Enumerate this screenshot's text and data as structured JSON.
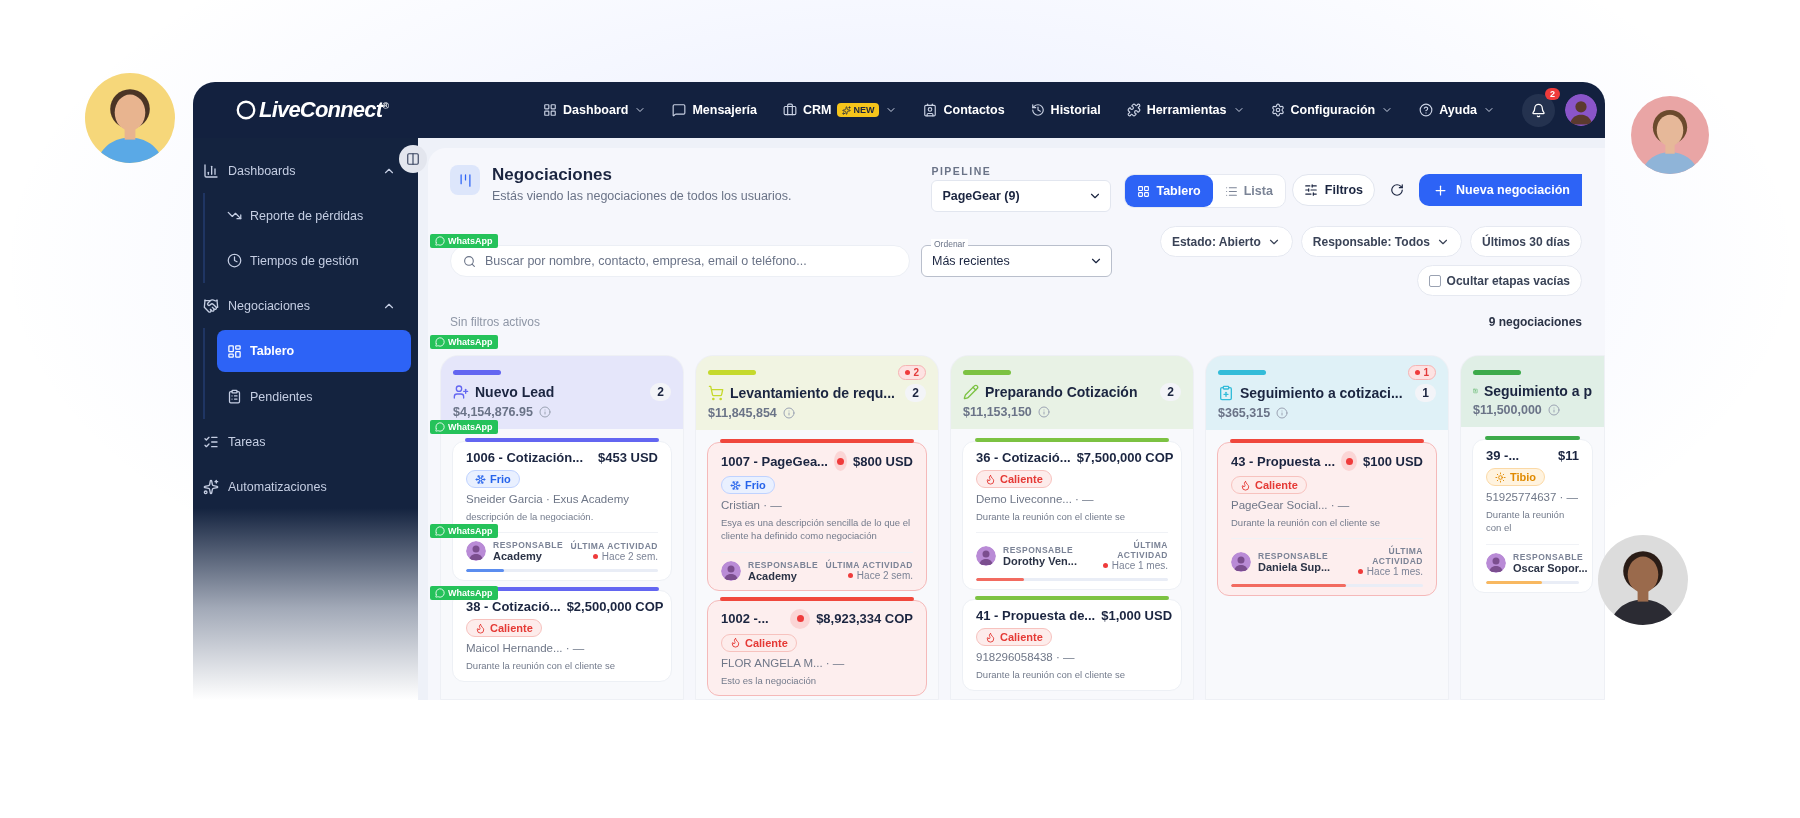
{
  "nav": {
    "logo": "LiveConnect$^{®}$",
    "items": [
      {
        "label": "Dashboard",
        "menu": true
      },
      {
        "label": "Mensajería",
        "menu": false
      },
      {
        "label": "CRM",
        "badge": "NEW",
        "menu": true
      },
      {
        "label": "Contactos",
        "menu": false
      },
      {
        "label": "Historial",
        "menu": false
      },
      {
        "label": "Herramientas",
        "menu": true
      },
      {
        "label": "Configuración",
        "menu": true
      },
      {
        "label": "Ayuda",
        "menu": true
      }
    ],
    "notifications": "2"
  },
  "sidebar": {
    "items": [
      {
        "label": "Dashboards",
        "expanded": true,
        "children": [
          {
            "label": "Reporte de pérdidas",
            "selected": false
          },
          {
            "label": "Tiempos de gestión",
            "selected": false
          }
        ]
      },
      {
        "label": "Negociaciones",
        "expanded": true,
        "children": [
          {
            "label": "Tablero",
            "selected": true
          },
          {
            "label": "Pendientes",
            "selected": false
          }
        ]
      },
      {
        "label": "Tareas"
      },
      {
        "label": "Automatizaciones"
      }
    ]
  },
  "header": {
    "title": "Negociaciones",
    "subtitle": "Estás viendo las negociaciones de todos los usuarios.",
    "pipeline": {
      "label": "PIPELINE",
      "value": "PageGear (9)"
    },
    "views": [
      {
        "label": "Tablero",
        "selected": true
      },
      {
        "label": "Lista",
        "selected": false
      }
    ],
    "filters_button": "Filtros",
    "new_button": "Nueva negociación",
    "search": {
      "placeholder": "Buscar por nombre, contacto, empresa, email o teléfono..."
    },
    "sort": {
      "label": "Ordenar",
      "value": "Más recientes"
    },
    "chips": [
      {
        "label": "Estado: Abierto",
        "menu": true
      },
      {
        "label": "Responsable: Todos",
        "menu": true
      },
      {
        "label": "Últimos 30 días",
        "menu": false
      }
    ],
    "hide_empty": {
      "label": "Ocultar etapas vacías",
      "checked": false
    },
    "active_filters": "Sin filtros activos",
    "total": "9 negociaciones"
  },
  "whatsapp_tags": [
    "WhatsApp",
    "WhatsApp",
    "WhatsApp",
    "WhatsApp",
    "WhatsApp"
  ],
  "columns": [
    {
      "title": "Nuevo Lead",
      "count": "2",
      "total": "$4,154,876.95",
      "color": "#6366f1",
      "cards": [
        {
          "title": "1006 - Cotización...",
          "amount": "$453 USD",
          "overdue": false,
          "temperature": {
            "kind": "cold",
            "label": "Frio"
          },
          "contact": "Sneider Garcia · Exus Academy",
          "description": "descripción de la negociación.",
          "owner_label": "RESPONSABLE",
          "owner": "Academy",
          "activity_label": "ÚLTIMA ACTIVIDAD",
          "activity": "Hace 2 sem.",
          "level": 0.2
        },
        {
          "title": "38 - Cotizació...",
          "amount": "$2,500,000 COP",
          "overdue": false,
          "temperature": {
            "kind": "hot",
            "label": "Caliente"
          },
          "contact": "Maicol Hernande... · —",
          "description": "Durante la reunión con el cliente se"
        }
      ]
    },
    {
      "title": "Levantamiento de requ...",
      "count": "2",
      "alert": "2",
      "total": "$11,845,854",
      "color": "#c5d92d",
      "cards": [
        {
          "title": "1007 - PageGea...",
          "amount": "$800 USD",
          "overdue": true,
          "temperature": {
            "kind": "cold",
            "label": "Frio"
          },
          "contact": "Cristian · —",
          "description": "Esya es una descripción sencilla de lo que el cliente ha definido como negociación",
          "owner_label": "RESPONSABLE",
          "owner": "Academy",
          "activity_label": "ÚLTIMA ACTIVIDAD",
          "activity": "Hace 2 sem."
        },
        {
          "title": "1002 -...",
          "amount": "$8,923,334 COP",
          "overdue": true,
          "temperature": {
            "kind": "hot",
            "label": "Caliente"
          },
          "contact": "FLOR ANGELA M... · —",
          "description": "Esto es la negociación"
        }
      ]
    },
    {
      "title": "Preparando Cotización",
      "count": "2",
      "total": "$11,153,150",
      "color": "#7cc242",
      "cards": [
        {
          "title": "36 - Cotizació...",
          "amount": "$7,500,000 COP",
          "overdue": false,
          "temperature": {
            "kind": "hot",
            "label": "Caliente"
          },
          "contact": "Demo Liveconne... · —",
          "description": "Durante la reunión con el cliente se",
          "owner_label": "RESPONSABLE",
          "owner": "Dorothy Ven...",
          "activity_label": "ÚLTIMA ACTIVIDAD",
          "activity": "Hace 1 mes.",
          "level": 0.25
        },
        {
          "title": "41 - Propuesta de...",
          "amount": "$1,000 USD",
          "overdue": false,
          "temperature": {
            "kind": "hot",
            "label": "Caliente"
          },
          "contact": "918296058438 · —",
          "description": "Durante la reunión con el cliente se"
        }
      ]
    },
    {
      "title": "Seguimiento a cotizaci...",
      "count": "1",
      "alert": "1",
      "total": "$365,315",
      "color": "#33bcd9",
      "cards": [
        {
          "title": "43 - Propuesta ...",
          "amount": "$100 USD",
          "overdue": true,
          "temperature": {
            "kind": "hot",
            "label": "Caliente"
          },
          "contact": "PageGear Social... · —",
          "description": "Durante la reunión con el cliente se",
          "owner_label": "RESPONSABLE",
          "owner": "Daniela Sup...",
          "activity_label": "ÚLTIMA ACTIVIDAD",
          "activity": "Hace 1 mes.",
          "level": 0.6
        }
      ]
    },
    {
      "title": "Seguimiento a p",
      "total": "$11,500,000",
      "color": "#3daa4b",
      "cards": [
        {
          "title": "39 -...",
          "amount": "$11",
          "overdue": false,
          "temperature": {
            "kind": "warm",
            "label": "Tibio"
          },
          "contact": "51925774637 · —",
          "description": "Durante la reunión con el",
          "owner_label": "RESPONSABLE",
          "owner": "Oscar Sopor...",
          "level": 0.6
        }
      ]
    }
  ]
}
